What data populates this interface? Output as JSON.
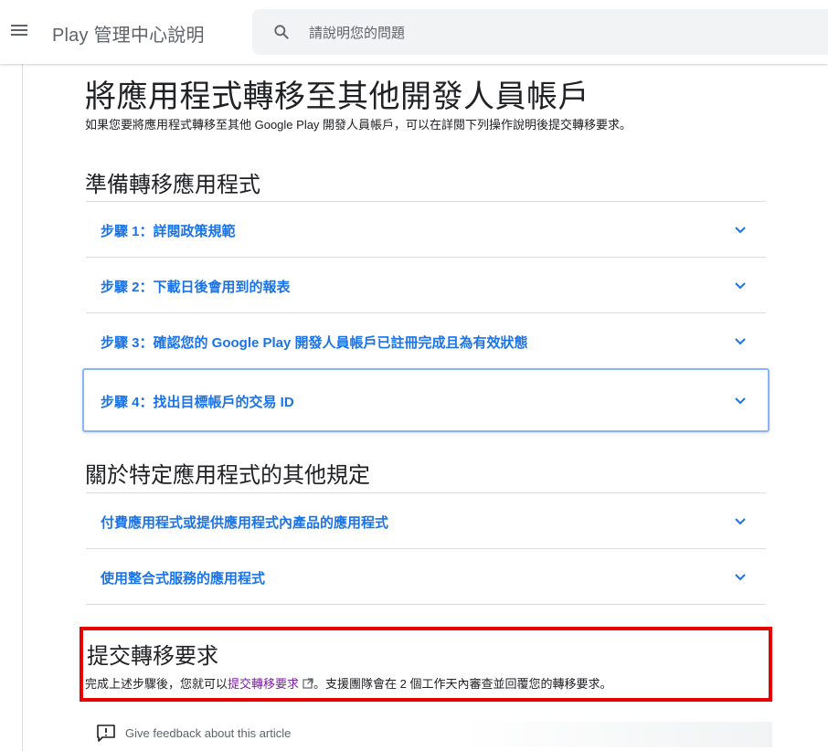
{
  "header": {
    "brand": "Play 管理中心說明",
    "search_placeholder": "請說明您的問題"
  },
  "article": {
    "title": "將應用程式轉移至其他開發人員帳戶",
    "intro": "如果您要將應用程式轉移至其他 Google Play 開發人員帳戶，可以在詳閱下列操作說明後提交轉移要求。",
    "sections": [
      {
        "heading": "準備轉移應用程式",
        "items": [
          "步驟 1：詳閱政策規範",
          "步驟 2：下載日後會用到的報表",
          "步驟 3：確認您的 Google Play 開發人員帳戶已註冊完成且為有效狀態",
          "步驟 4：找出目標帳戶的交易 ID"
        ]
      },
      {
        "heading": "關於特定應用程式的其他規定",
        "items": [
          "付費應用程式或提供應用程式內產品的應用程式",
          "使用整合式服務的應用程式"
        ]
      }
    ],
    "submit": {
      "heading": "提交轉移要求",
      "text_before": "完成上述步驟後，您就可以",
      "link": "提交轉移要求",
      "text_after": "。支援團隊會在 2 個工作天內審查並回覆您的轉移要求。"
    }
  },
  "feedback": {
    "label": "Give feedback about this article"
  },
  "colors": {
    "link_blue": "#1a73e8",
    "visited_purple": "#7b1fa2",
    "highlight_red": "#e60000",
    "focus_border": "#8ab4f8"
  }
}
